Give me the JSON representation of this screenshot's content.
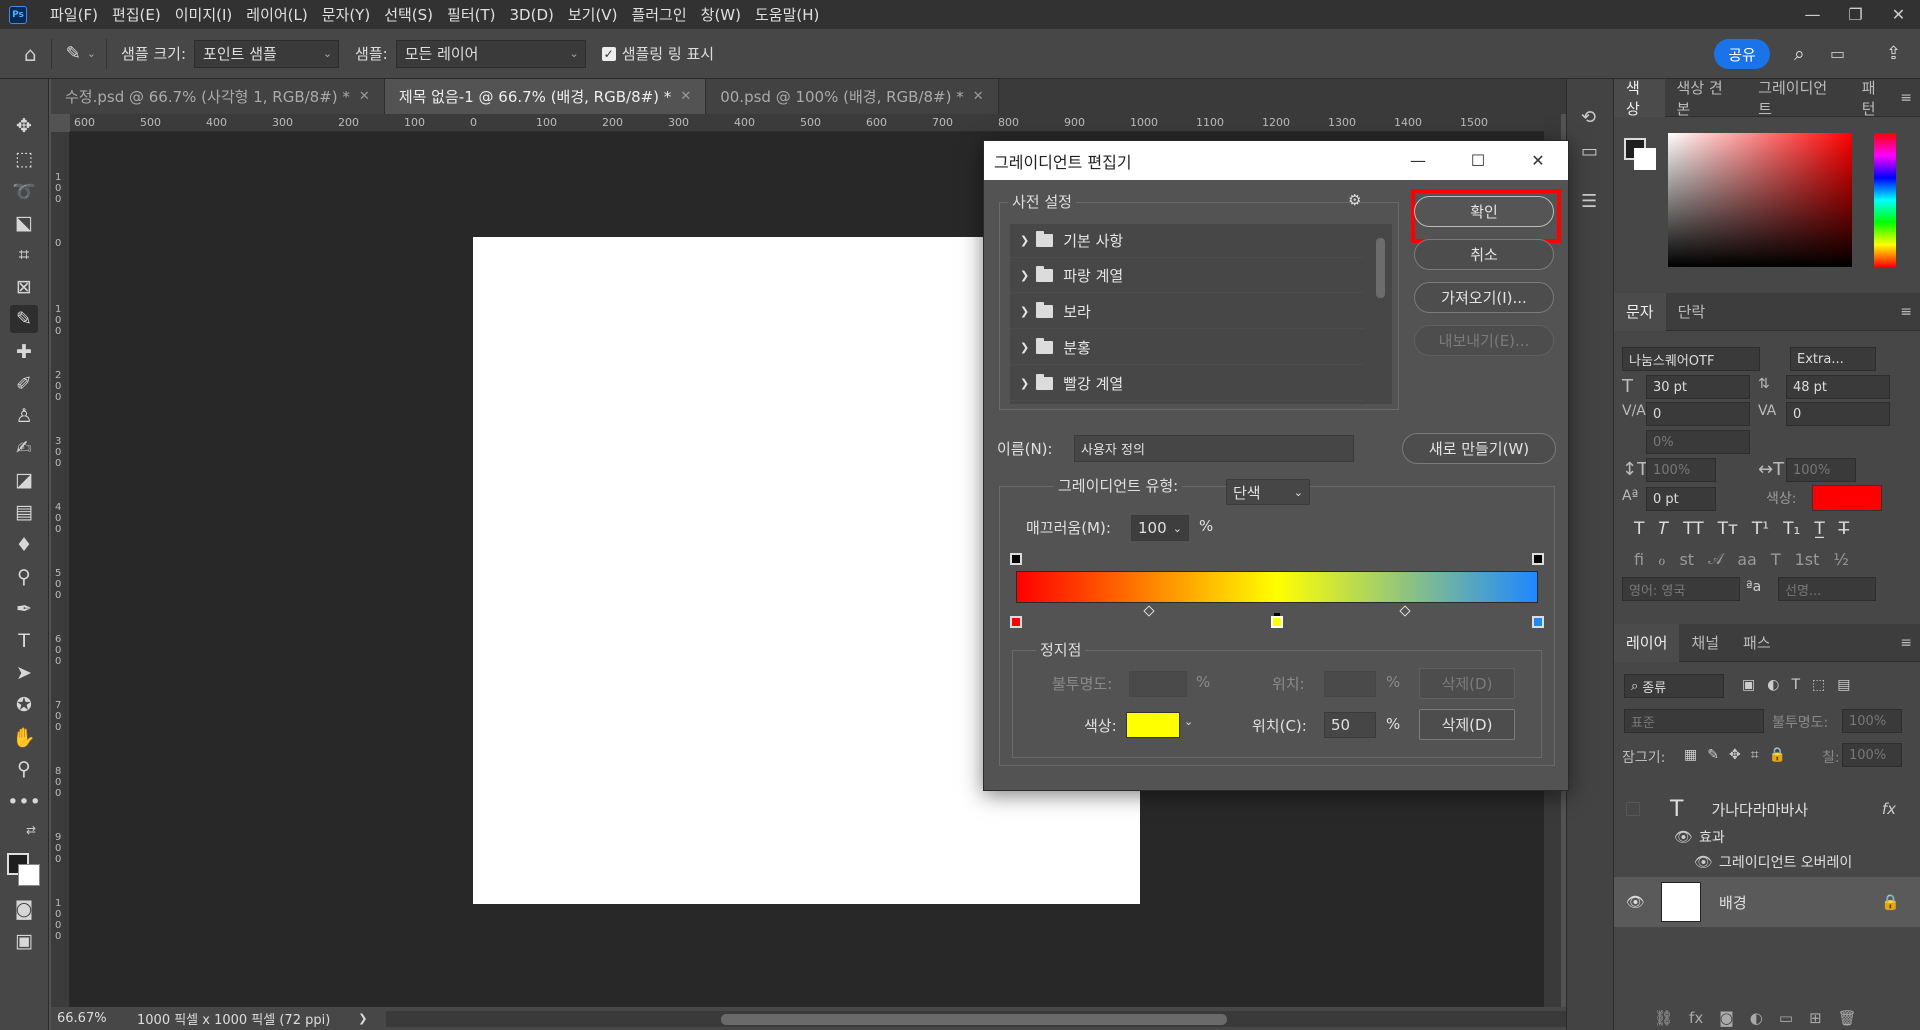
{
  "menubar": {
    "logo": "Ps",
    "items": [
      "파일(F)",
      "편집(E)",
      "이미지(I)",
      "레이어(L)",
      "문자(Y)",
      "선택(S)",
      "필터(T)",
      "3D(D)",
      "보기(V)",
      "플러그인",
      "창(W)",
      "도움말(H)"
    ],
    "win_min": "—",
    "win_restore": "❐",
    "win_close": "✕"
  },
  "options": {
    "sample_size_label": "샘플 크기:",
    "sample_size_value": "포인트 샘플",
    "sample_label": "샘플:",
    "sample_value": "모든 레이어",
    "show_ring_label": "샘플링 링 표시",
    "share": "공유"
  },
  "tabs": [
    {
      "label": "수정.psd @ 66.7% (사각형 1, RGB/8#) *"
    },
    {
      "label": "제목 없음-1 @ 66.7% (배경, RGB/8#) *"
    },
    {
      "label": "00.psd @ 100% (배경, RGB/8#) *"
    }
  ],
  "hruler": [
    "600",
    "500",
    "400",
    "300",
    "200",
    "100",
    "0",
    "100",
    "200",
    "300",
    "400",
    "500",
    "600",
    "700",
    "800",
    "900",
    "1000",
    "1100",
    "1200",
    "1300",
    "1400",
    "1500"
  ],
  "vruler": [
    "1 0 0",
    "0",
    "1 0 0",
    "2 0 0",
    "3 0 0",
    "4 0 0",
    "5 0 0",
    "6 0 0",
    "7 0 0",
    "8 0 0",
    "9 0 0",
    "1 0 0 0"
  ],
  "status": {
    "zoom": "66.67%",
    "doc_size": "1000 픽셀 x 1000 픽셀 (72 ppi)",
    "arrow": "❯"
  },
  "dialog": {
    "title": "그레이디언트 편집기",
    "presets_label": "사전 설정",
    "presets": [
      "기본 사항",
      "파랑 계열",
      "보라",
      "분홍",
      "빨강 계열"
    ],
    "ok": "확인",
    "cancel": "취소",
    "import": "가져오기(I)...",
    "export": "내보내기(E)...",
    "name_label": "이름(N):",
    "name_value": "사용자 정의",
    "new_button": "새로 만들기(W)",
    "type_label": "그레이디언트 유형:",
    "type_value": "단색",
    "smoothness_label": "매끄러움(M):",
    "smoothness_value": "100",
    "percent": "%",
    "stops_label": "정지점",
    "opacity_label": "불투명도:",
    "location_label_top": "위치:",
    "delete_label_top": "삭제(D)",
    "color_label": "색상:",
    "location_label": "위치(C):",
    "location_value": "50",
    "delete_label": "삭제(D)",
    "gradient_colors": [
      "#ff0000",
      "#ffff00",
      "#1e88ff"
    ],
    "stop_color": "#ffff00"
  },
  "color_panel": {
    "tabs": [
      "색상",
      "색상 견본",
      "그레이디언트",
      "패턴"
    ]
  },
  "char_panel": {
    "tabs": [
      "문자",
      "단락"
    ],
    "font_family": "나눔스퀘어OTF",
    "font_style": "Extra...",
    "size": "30 pt",
    "leading": "48 pt",
    "kerning": "0",
    "tracking": "0",
    "scale_pct": "0%",
    "vscale": "100%",
    "hscale": "100%",
    "baseline": "0 pt",
    "color_label": "색상:",
    "color": "#ff0000",
    "lang": "영어: 영국",
    "aa_label": "ªa",
    "aa_value": "선명..."
  },
  "layers_panel": {
    "tabs": [
      "레이어",
      "채널",
      "패스"
    ],
    "search": "종류",
    "blend": "표준",
    "opacity_label": "불투명도:",
    "opacity": "100%",
    "lock_label": "잠그기:",
    "fill_label": "칠:",
    "fill": "100%",
    "layers": [
      {
        "name": "가나다라마바사",
        "kind": "T"
      },
      {
        "name": "효과"
      },
      {
        "name": "그레이디언트 오버레이"
      },
      {
        "name": "배경"
      }
    ]
  }
}
